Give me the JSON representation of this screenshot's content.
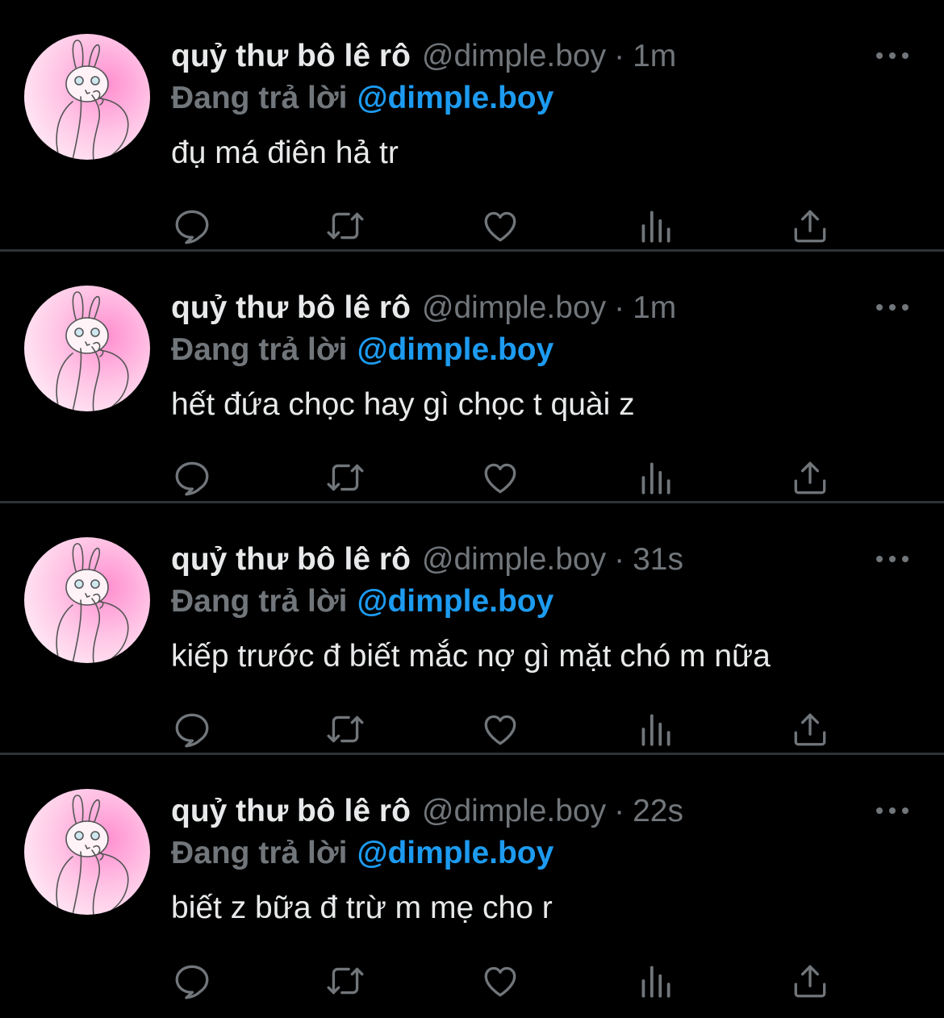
{
  "colors": {
    "background": "#000000",
    "text_primary": "#e7e9ea",
    "text_secondary": "#71767b",
    "accent": "#1d9bf0",
    "divider": "#2f3336"
  },
  "tweets": [
    {
      "display_name": "quỷ thư bô lê rô",
      "handle": "@dimple.boy",
      "separator": "·",
      "time": "1m",
      "reply_prefix": "Đang trả lời",
      "reply_to": "@dimple.boy",
      "text": "đụ má điên hả tr",
      "avatar_icon": "avatar-bunny-illustration",
      "actions": [
        "reply-icon",
        "retweet-icon",
        "like-icon",
        "analytics-icon",
        "share-icon"
      ]
    },
    {
      "display_name": "quỷ thư bô lê rô",
      "handle": "@dimple.boy",
      "separator": "·",
      "time": "1m",
      "reply_prefix": "Đang trả lời",
      "reply_to": "@dimple.boy",
      "text": "hết đứa chọc hay gì chọc t quài z",
      "avatar_icon": "avatar-bunny-illustration",
      "actions": [
        "reply-icon",
        "retweet-icon",
        "like-icon",
        "analytics-icon",
        "share-icon"
      ]
    },
    {
      "display_name": "quỷ thư bô lê rô",
      "handle": "@dimple.boy",
      "separator": "·",
      "time": "31s",
      "reply_prefix": "Đang trả lời",
      "reply_to": "@dimple.boy",
      "text": "kiếp trước đ biết mắc nợ gì mặt chó m nữa",
      "avatar_icon": "avatar-bunny-illustration",
      "actions": [
        "reply-icon",
        "retweet-icon",
        "like-icon",
        "analytics-icon",
        "share-icon"
      ]
    },
    {
      "display_name": "quỷ thư bô lê rô",
      "handle": "@dimple.boy",
      "separator": "·",
      "time": "22s",
      "reply_prefix": "Đang trả lời",
      "reply_to": "@dimple.boy",
      "text": "biết z bữa đ trừ m mẹ cho r",
      "avatar_icon": "avatar-bunny-illustration",
      "actions": [
        "reply-icon",
        "retweet-icon",
        "like-icon",
        "analytics-icon",
        "share-icon"
      ]
    }
  ]
}
